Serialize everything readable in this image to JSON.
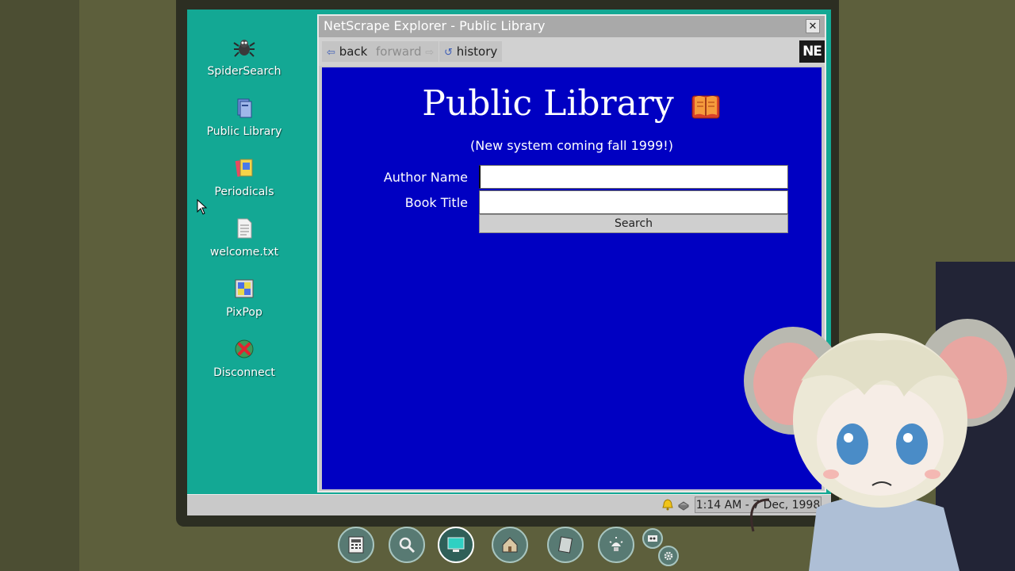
{
  "desktop": {
    "icons": [
      {
        "label": "SpiderSearch",
        "icon": "spider-icon"
      },
      {
        "label": "Public Library",
        "icon": "books-icon"
      },
      {
        "label": "Periodicals",
        "icon": "magazine-icon"
      },
      {
        "label": "welcome.txt",
        "icon": "text-file-icon"
      },
      {
        "label": "PixPop",
        "icon": "paint-icon"
      },
      {
        "label": "Disconnect",
        "icon": "disconnect-globe-icon"
      }
    ]
  },
  "browser": {
    "title": "NetScrape Explorer - Public Library",
    "close_label": "✕",
    "toolbar": {
      "back_label": "back",
      "forward_label": "forward",
      "history_label": "history",
      "logo_text": "NE"
    },
    "page": {
      "title": "Public Library",
      "subtitle": "(New system coming fall 1999!)",
      "author_label": "Author Name",
      "author_value": "",
      "title_label": "Book Title",
      "title_value": "",
      "search_label": "Search"
    }
  },
  "taskbar": {
    "clock": "1:14 AM - 7 Dec, 1998"
  },
  "dock": {
    "items": [
      "calculator-icon",
      "magnifier-icon",
      "computer-icon",
      "home-icon",
      "notebook-icon",
      "lamp-icon",
      "tape-icon",
      "gear-icon"
    ]
  },
  "colors": {
    "desktop": "#13a894",
    "page_background": "#0000c2",
    "titlebar": "#a9a9a9"
  }
}
